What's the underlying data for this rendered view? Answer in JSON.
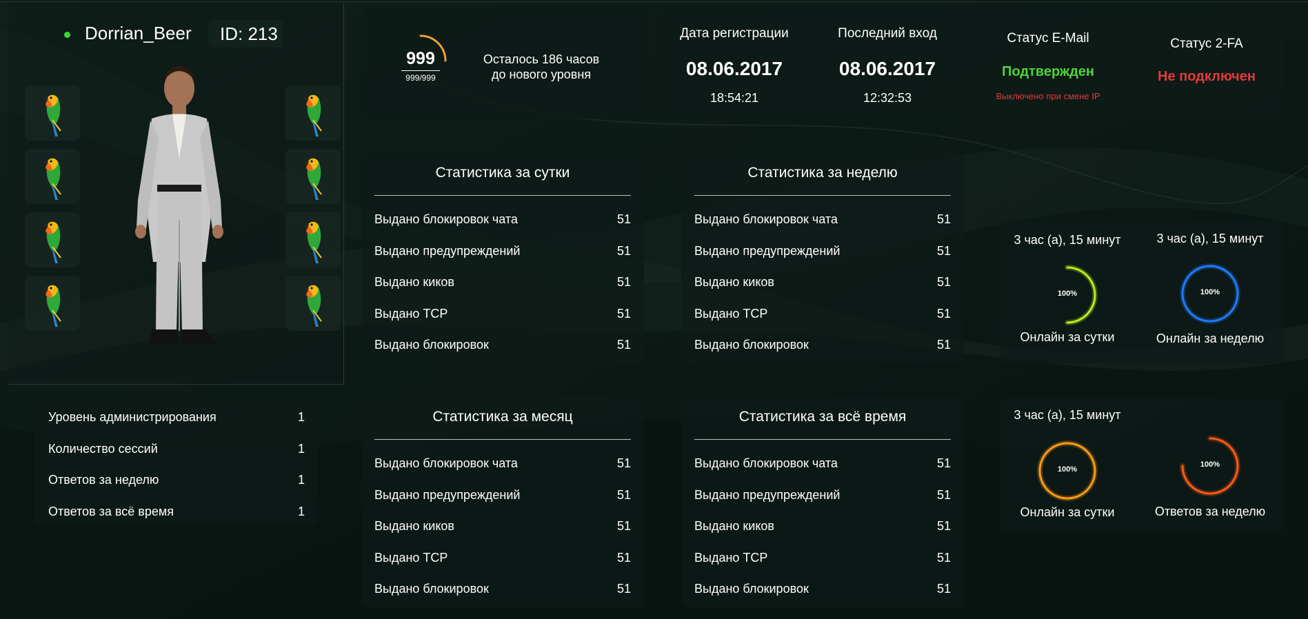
{
  "player": {
    "nickname": "Dorrian_Beer",
    "id_label": "ID: 213",
    "status_color": "#3bd63b",
    "inventory_slots": [
      "parrot-icon",
      "parrot-icon",
      "parrot-icon",
      "parrot-icon",
      "parrot-icon",
      "parrot-icon",
      "parrot-icon",
      "parrot-icon"
    ]
  },
  "level": {
    "value": "999",
    "progress_text": "999/999",
    "remaining_line1": "Осталось 186 часов",
    "remaining_line2": "до нового уровня",
    "ring_fraction": 0.25,
    "ring_color": "#f0a030"
  },
  "registration": {
    "label": "Дата регистрации",
    "date": "08.06.2017",
    "time": "18:54:21"
  },
  "last_login": {
    "label": "Последний вход",
    "date": "08.06.2017",
    "time": "12:32:53"
  },
  "email_status": {
    "label": "Статус E-Mail",
    "value": "Подтвержден",
    "note": "Выключено при смене IP",
    "value_color": "#4fd43a",
    "note_color": "#e23b3b"
  },
  "twofa_status": {
    "label": "Статус 2-FA",
    "value": "Не подключен",
    "value_color": "#e23b3b"
  },
  "admin_info": [
    {
      "label": "Уровень администрирования",
      "value": "1"
    },
    {
      "label": "Количество сессий",
      "value": "1"
    },
    {
      "label": "Ответов за неделю",
      "value": "1"
    },
    {
      "label": "Ответов за всё время",
      "value": "1"
    }
  ],
  "stats": [
    {
      "title": "Статистика за сутки",
      "rows": [
        {
          "label": "Выдано блокировок чата",
          "value": "51"
        },
        {
          "label": "Выдано предупреждений",
          "value": "51"
        },
        {
          "label": "Выдано киков",
          "value": "51"
        },
        {
          "label": "Выдано TCP",
          "value": "51"
        },
        {
          "label": "Выдано блокировок",
          "value": "51"
        }
      ]
    },
    {
      "title": "Статистика за неделю",
      "rows": [
        {
          "label": "Выдано блокировок чата",
          "value": "51"
        },
        {
          "label": "Выдано предупреждений",
          "value": "51"
        },
        {
          "label": "Выдано киков",
          "value": "51"
        },
        {
          "label": "Выдано TCP",
          "value": "51"
        },
        {
          "label": "Выдано блокировок",
          "value": "51"
        }
      ]
    },
    {
      "title": "Статистика за месяц",
      "rows": [
        {
          "label": "Выдано блокировок чата",
          "value": "51"
        },
        {
          "label": "Выдано предупреждений",
          "value": "51"
        },
        {
          "label": "Выдано киков",
          "value": "51"
        },
        {
          "label": "Выдано TCP",
          "value": "51"
        },
        {
          "label": "Выдано блокировок",
          "value": "51"
        }
      ]
    },
    {
      "title": "Статистика за всё время",
      "rows": [
        {
          "label": "Выдано блокировок чата",
          "value": "51"
        },
        {
          "label": "Выдано предупреждений",
          "value": "51"
        },
        {
          "label": "Выдано киков",
          "value": "51"
        },
        {
          "label": "Выдано TCP",
          "value": "51"
        },
        {
          "label": "Выдано блокировок",
          "value": "51"
        }
      ]
    }
  ],
  "online": [
    {
      "duration": "3 час (а), 15 минут",
      "percent_label": "100%",
      "caption": "Онлайн за сутки",
      "color": "#b8f01a",
      "fraction": 0.5
    },
    {
      "duration": "3 час (а), 15 минут",
      "percent_label": "100%",
      "caption": "Онлайн за неделю",
      "color": "#1e7bff",
      "fraction": 1
    },
    {
      "duration": "3 час (а), 15 минут",
      "percent_label": "100%",
      "caption": "Онлайн за сутки",
      "color": "#ff9a12",
      "fraction": 1
    },
    {
      "duration": "",
      "percent_label": "100%",
      "caption": "Ответов за неделю",
      "color": "#ff5a12",
      "fraction": 0.75
    }
  ]
}
